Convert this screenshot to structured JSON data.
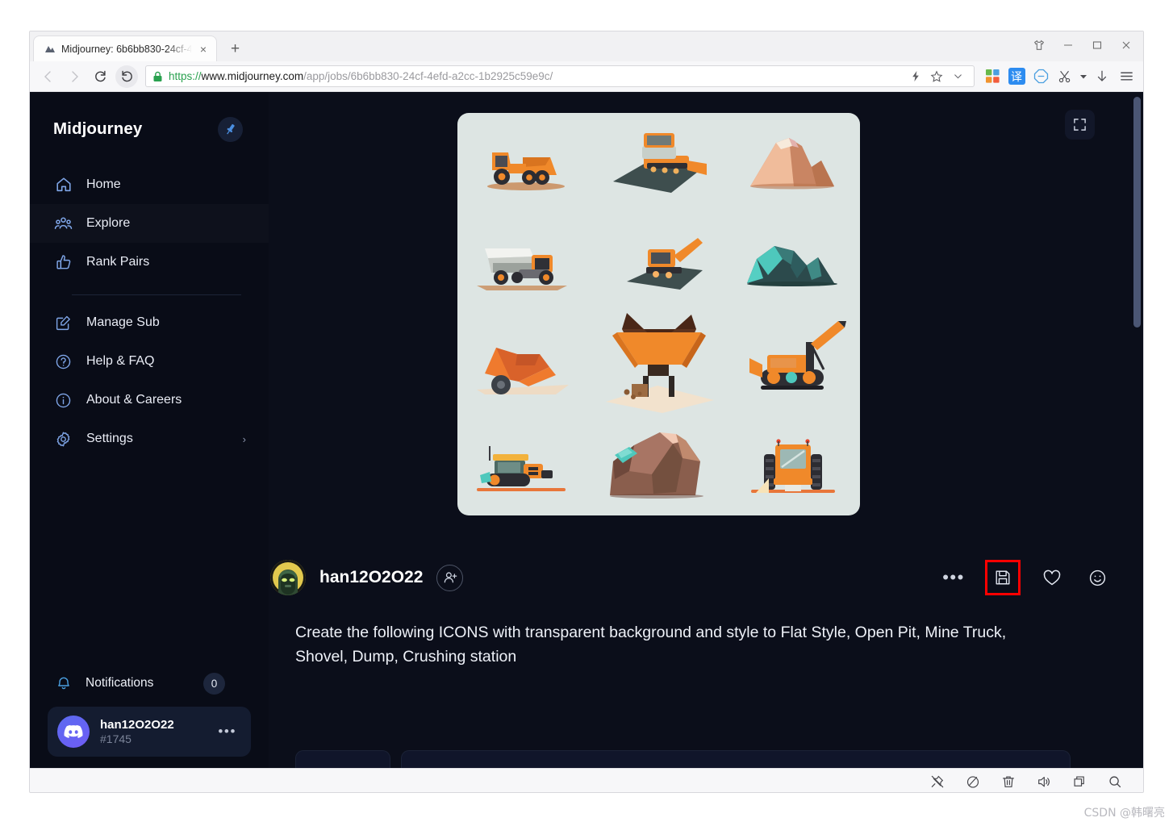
{
  "browser": {
    "tab": {
      "title": "Midjourney: 6b6bb830-24cf-4",
      "favicon_name": "midjourney-favicon",
      "close_label": "×"
    },
    "new_tab_label": "+",
    "window_controls": {
      "theme_label": "theme-shirt",
      "minimize_label": "−",
      "maximize_label": "□",
      "close_label": "✕"
    },
    "nav": {
      "back_label": "‹",
      "forward_label": "›",
      "reload_label": "reload",
      "history_label": "history-back"
    },
    "url": {
      "scheme": "https://",
      "host": "www.midjourney.com",
      "path": "/app/jobs/6b6bb830-24cf-4efd-a2cc-1b2925c59e9c/",
      "full": "https://www.midjourney.com/app/jobs/6b6bb830-24cf-4efd-a2cc-1b2925c59e9c/",
      "secure": true
    },
    "omnibox_icons": [
      "lock-icon",
      "lightning-icon",
      "bookmark-star-icon",
      "chevron-down-icon"
    ],
    "toolbar_icons": [
      "grid-extensions-icon",
      "translate-icon",
      "adblock-icon",
      "screenshot-scissors-icon",
      "downloads-icon",
      "menu-hamburger-icon"
    ],
    "translate_glyph": "译"
  },
  "sidebar": {
    "brand": "Midjourney",
    "pin_label": "pin",
    "primary_items": [
      {
        "label": "Home",
        "icon": "home-icon"
      },
      {
        "label": "Explore",
        "icon": "explore-people-icon"
      },
      {
        "label": "Rank Pairs",
        "icon": "thumbs-up-icon"
      }
    ],
    "secondary_items": [
      {
        "label": "Manage Sub",
        "icon": "edit-square-icon"
      },
      {
        "label": "Help & FAQ",
        "icon": "question-circle-icon"
      },
      {
        "label": "About & Careers",
        "icon": "info-circle-icon"
      },
      {
        "label": "Settings",
        "icon": "gear-icon",
        "chevron": "›"
      }
    ],
    "notifications": {
      "label": "Notifications",
      "count": "0",
      "icon": "bell-icon"
    },
    "account": {
      "name": "han12O2O22",
      "tag": "#1745",
      "more_label": "•••",
      "avatar": "discord-logo"
    }
  },
  "main": {
    "expand_label": "expand-fullscreen",
    "author": {
      "name": "han12O2O22",
      "follow_label": "add-user",
      "avatar": "hooded-figure-avatar"
    },
    "actions": {
      "more_label": "•••",
      "save_label": "save-floppy",
      "like_label": "heart",
      "react_label": "smiley"
    },
    "prompt": "Create the following ICONS with transparent background and style to Flat Style, Open Pit, Mine Truck, Shovel, Dump, Crushing station",
    "image": {
      "background": "#dde5e3",
      "accent": "#f08a2a",
      "icons": [
        "mine-dump-truck-side",
        "bulldozer-on-platform",
        "open-pit-mound-tan",
        "white-dump-loader",
        "excavator-arm-dark",
        "teal-ore-rocks",
        "orange-shovel-scoop",
        "crushing-station-hopper",
        "tracked-excavator-crane",
        "orange-tracked-vehicle",
        "brown-rock-with-water",
        "front-view-mine-truck"
      ]
    }
  },
  "status_bar": {
    "icons": [
      "pin-crossed-icon",
      "no-entry-icon",
      "trash-icon",
      "speaker-icon",
      "windows-icon",
      "search-icon"
    ]
  },
  "watermark": "CSDN @韩曙亮",
  "colors": {
    "page_bg": "#0b0e1a",
    "sidebar_bg": "#090c17",
    "accent_blue": "#7fa6e8",
    "highlight_red": "#ff0000",
    "discord_purple": "#5b6bf0"
  }
}
